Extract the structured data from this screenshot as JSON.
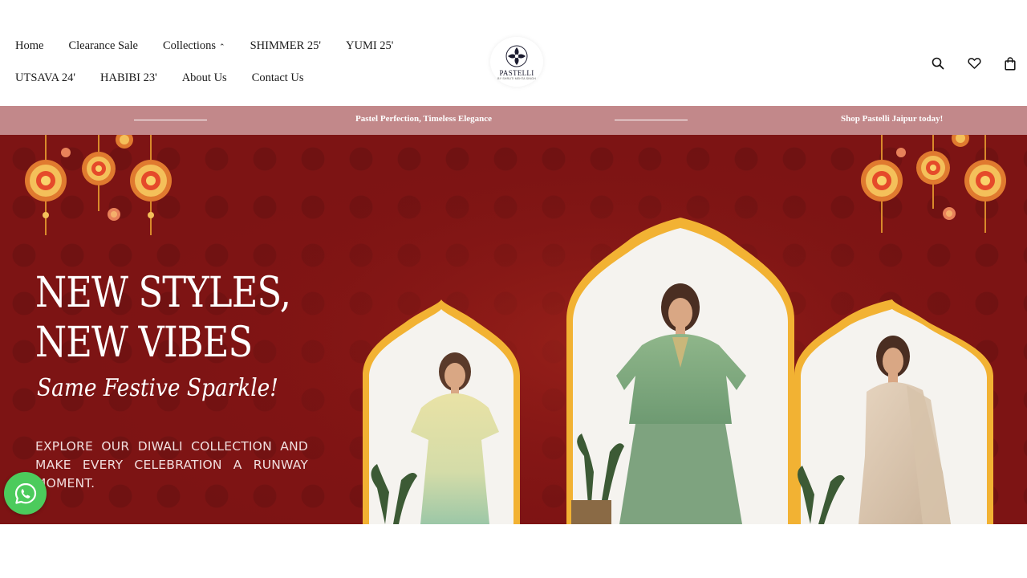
{
  "nav": {
    "row1": [
      {
        "label": "Home"
      },
      {
        "label": "Clearance Sale"
      },
      {
        "label": "Collections",
        "has_dropdown": true
      },
      {
        "label": "SHIMMER 25'"
      },
      {
        "label": "YUMI 25'"
      }
    ],
    "row2": [
      {
        "label": "UTSAVA 24'"
      },
      {
        "label": "HABIBI 23'"
      },
      {
        "label": "About Us"
      },
      {
        "label": "Contact Us"
      }
    ]
  },
  "logo": {
    "name": "PASTELLI",
    "subtitle": "BY SHRUTI MEHTA SINGH"
  },
  "header_icons": [
    "search-icon",
    "wishlist-heart-icon",
    "cart-bag-icon"
  ],
  "announcement": {
    "messages": [
      "Pastel Perfection, Timeless Elegance",
      "Shop Pastelli Jaipur today!"
    ],
    "background": "#c2888a"
  },
  "hero": {
    "title_line1": "NEW STYLES,",
    "title_line2": "NEW VIBES",
    "script": "Same Festive Sparkle!",
    "description": "EXPLORE OUR DIWALI COLLECTION AND MAKE EVERY CELEBRATION A RUNWAY MOMENT.",
    "background": "#7d1414",
    "arch_color": "#f2b233"
  },
  "floating": {
    "whatsapp_icon": "whatsapp-icon",
    "color": "#4ccb5c"
  }
}
